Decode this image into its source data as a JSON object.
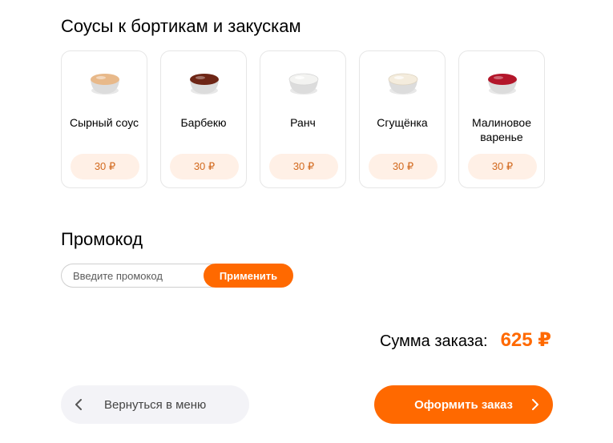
{
  "sauces": {
    "title": "Соусы к бортикам и закускам",
    "items": [
      {
        "name": "Сырный соус",
        "price": "30 ₽",
        "icon": "cheese-sauce-bowl-icon",
        "color": "#e8b98a"
      },
      {
        "name": "Барбекю",
        "price": "30 ₽",
        "icon": "bbq-sauce-bowl-icon",
        "color": "#6e2616"
      },
      {
        "name": "Ранч",
        "price": "30 ₽",
        "icon": "ranch-sauce-bowl-icon",
        "color": "#f3f3f1"
      },
      {
        "name": "Сгущёнка",
        "price": "30 ₽",
        "icon": "condensed-milk-bowl-icon",
        "color": "#f4ecdd"
      },
      {
        "name": "Малиновое варенье",
        "price": "30 ₽",
        "icon": "raspberry-jam-bowl-icon",
        "color": "#b3162a"
      }
    ]
  },
  "promo": {
    "title": "Промокод",
    "placeholder": "Введите промокод",
    "apply_label": "Применить"
  },
  "total": {
    "label": "Сумма заказа:",
    "value": "625 ₽"
  },
  "actions": {
    "back_label": "Вернуться в меню",
    "back_icon": "chevron-left-icon",
    "order_label": "Оформить заказ",
    "order_icon": "chevron-right-icon"
  },
  "colors": {
    "accent": "#ff6900",
    "price_chip_bg": "#fff0e6",
    "price_text": "#d2691e"
  }
}
